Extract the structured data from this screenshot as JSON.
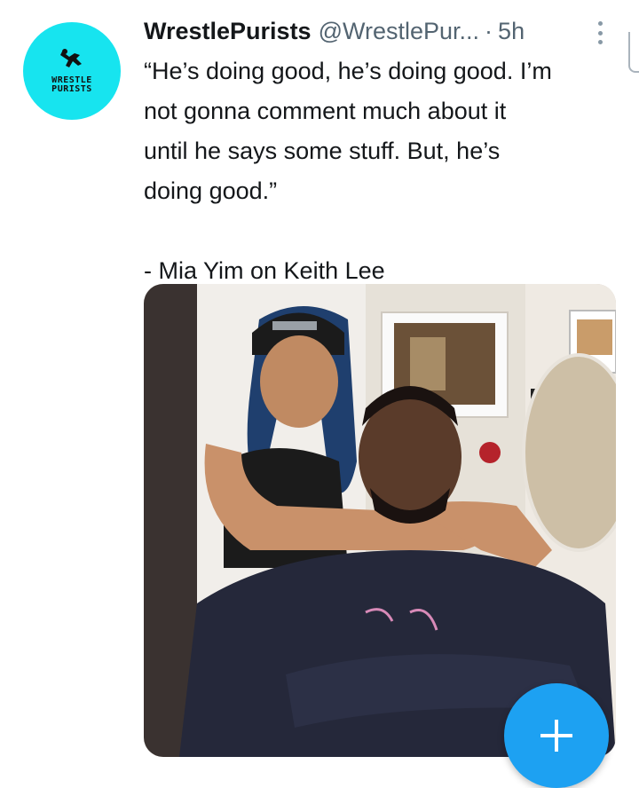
{
  "tweet": {
    "author_name": "WrestlePurists",
    "author_handle": "@WrestlePur...",
    "separator": "·",
    "timestamp": "5h",
    "text_lines": [
      "“He’s doing good, he’s doing good. I’m",
      "not gonna comment much about it",
      "until he says some stuff. But, he’s",
      "doing good.”"
    ],
    "attribution": "- Mia Yim on Keith Lee"
  },
  "avatar": {
    "logo_line1": "WRESTLE",
    "logo_line2": "PURISTS",
    "color": "#17e4ef"
  },
  "icons": {
    "more": "more-vertical-icon",
    "compose": "plus-icon"
  },
  "colors": {
    "accent": "#1da1f2",
    "text": "#14171a",
    "secondary_text": "#536471"
  }
}
